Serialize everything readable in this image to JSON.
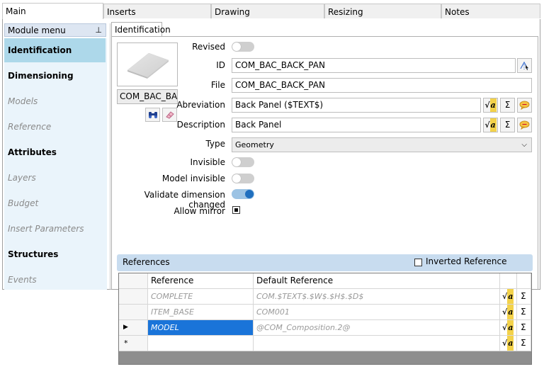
{
  "top_tabs": [
    {
      "label": "Main",
      "active": true
    },
    {
      "label": "Inserts",
      "active": false
    },
    {
      "label": "Drawing",
      "active": false
    },
    {
      "label": "Resizing",
      "active": false
    },
    {
      "label": "Notes",
      "active": false
    }
  ],
  "module_menu": {
    "title": "Module menu",
    "pin_icon": "pin-icon",
    "items": [
      {
        "label": "Identification",
        "style": "selected"
      },
      {
        "label": "Dimensioning",
        "style": "bold"
      },
      {
        "label": "Models",
        "style": "disabled"
      },
      {
        "label": "Reference",
        "style": "disabled"
      },
      {
        "label": "Attributes",
        "style": "bold"
      },
      {
        "label": "Layers",
        "style": "disabled"
      },
      {
        "label": "Budget",
        "style": "disabled"
      },
      {
        "label": "Insert Parameters",
        "style": "disabled"
      },
      {
        "label": "Structures",
        "style": "bold"
      },
      {
        "label": "Events",
        "style": "disabled"
      }
    ]
  },
  "identification": {
    "tab_label": "Identification",
    "thumbnail_name": "COM_BAC_BACK_PAN",
    "revised_label": "Revised",
    "revised_on": false,
    "id_label": "ID",
    "id_value": "COM_BAC_BACK_PAN",
    "file_label": "File",
    "file_value": "COM_BAC_BACK_PAN",
    "abreviation_label": "Abreviation",
    "abreviation_value": "Back Panel ($TEXT$)",
    "description_label": "Description",
    "description_value": "Back Panel",
    "type_label": "Type",
    "type_value": "Geometry",
    "invisible_label": "Invisible",
    "invisible_on": false,
    "model_invisible_label": "Model invisible",
    "model_invisible_on": false,
    "validate_label": "Validate dimension changed",
    "validate_on": true,
    "allow_mirror_label": "Allow mirror",
    "allow_mirror_checked": true
  },
  "references": {
    "title": "References",
    "inverted_label": "Inverted Reference",
    "inverted_checked": false,
    "columns": [
      "Reference",
      "Default Reference"
    ],
    "rows": [
      {
        "reference": "COMPLETE",
        "default": "COM.$TEXT$.$W$.$H$.$D$",
        "selected": false,
        "marker": ""
      },
      {
        "reference": "ITEM_BASE",
        "default": "COM001",
        "selected": false,
        "marker": ""
      },
      {
        "reference": "MODEL",
        "default": "@COM_Composition.2@",
        "selected": true,
        "marker": "▶"
      },
      {
        "reference": "",
        "default": "",
        "selected": false,
        "marker": "*"
      }
    ],
    "sigma": "Σ",
    "formula_a": "a"
  },
  "accent_color": "#1a74d9",
  "menu_bg": "#eaf4fb"
}
